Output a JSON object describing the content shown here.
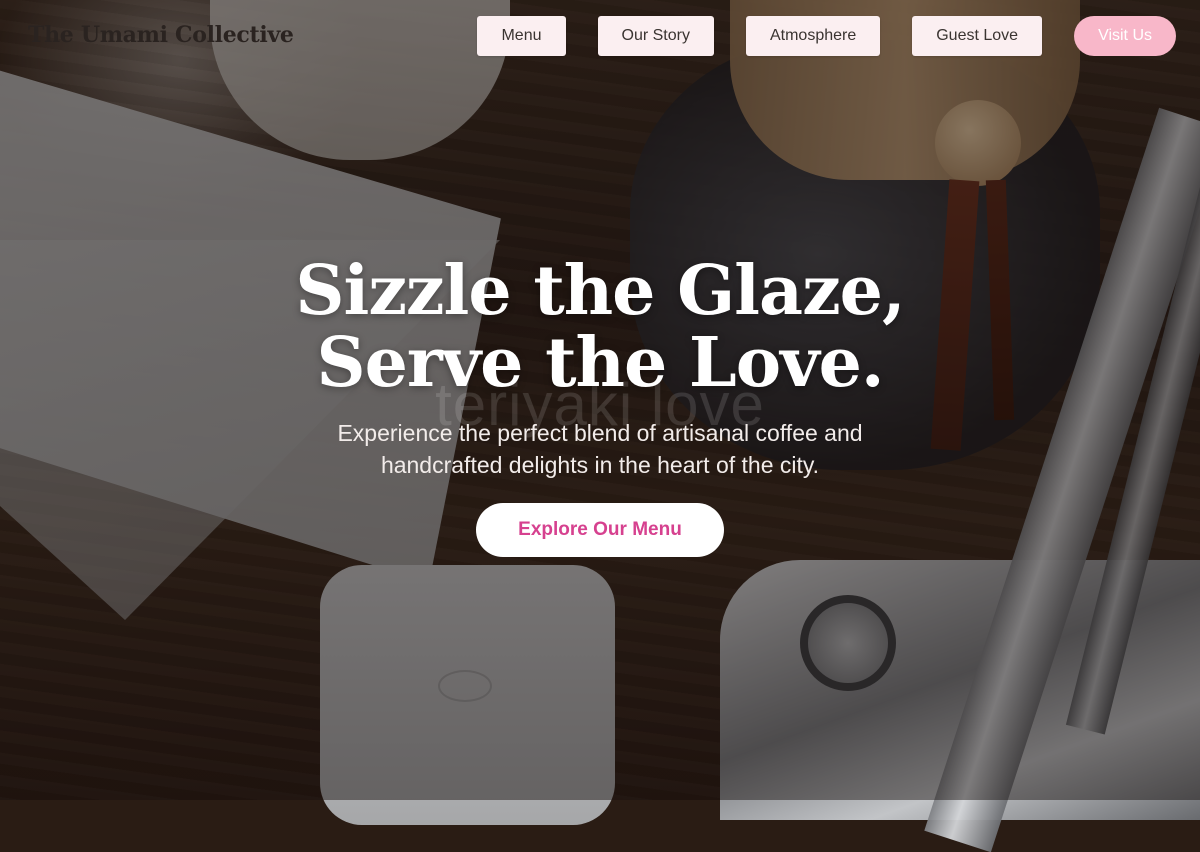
{
  "brand": {
    "name": "The Umami Collective"
  },
  "nav": {
    "items": [
      {
        "label": "Menu"
      },
      {
        "label": "Our Story"
      },
      {
        "label": "Atmosphere"
      },
      {
        "label": "Guest Love"
      }
    ],
    "cta_label": "Visit Us"
  },
  "hero": {
    "title_line1": "Sizzle the Glaze,",
    "title_line2": "Serve the Love.",
    "watermark": "teriyaki love",
    "subtitle": "Experience the perfect blend of artisanal coffee and handcrafted delights in the heart of the city.",
    "button_label": "Explore Our Menu"
  },
  "colors": {
    "nav_button_bg": "#fbeff1",
    "cta_bg": "#f8b7c9",
    "accent_pink": "#d6418f",
    "overlay": "rgba(20,14,10,0.45)"
  },
  "background_image": "coffee-bar-with-chemex-carafe-and-espresso-machine"
}
